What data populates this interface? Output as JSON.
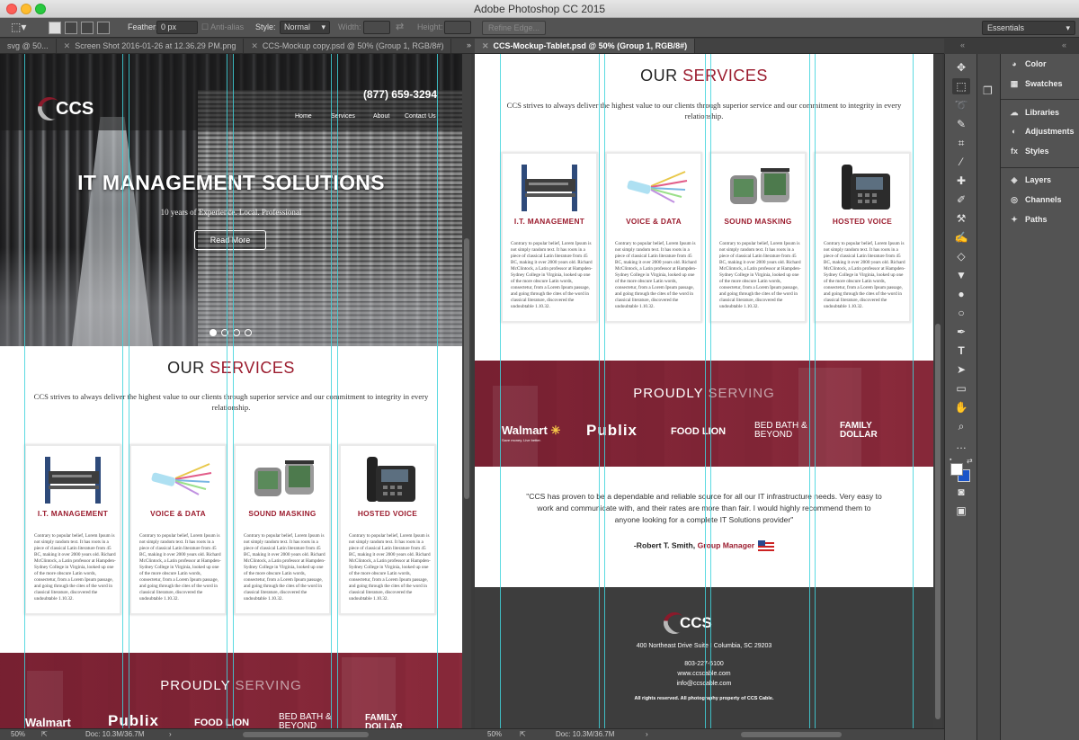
{
  "app": {
    "title": "Adobe Photoshop CC 2015"
  },
  "options_bar": {
    "feather_label": "Feather:",
    "feather_value": "0 px",
    "antialias_label": "Anti-alias",
    "style_label": "Style:",
    "style_value": "Normal",
    "width_label": "Width:",
    "height_label": "Height:",
    "refine_edge": "Refine Edge...",
    "workspace": "Essentials"
  },
  "tabs_left": [
    "svg @ 50...",
    "Screen Shot 2016-01-26 at 12.36.29 PM.png",
    "CCS-Mockup copy.psd @ 50% (Group 1, RGB/8#)"
  ],
  "tab_right": "CCS-Mockup-Tablet.psd @ 50% (Group 1, RGB/8#)",
  "status": {
    "zoom": "50%",
    "doc": "Doc: 10.3M/36.7M"
  },
  "site": {
    "logo": "CCS",
    "phone": "(877) 659-3294",
    "nav": [
      "Home",
      "Services",
      "About",
      "Contact Us"
    ],
    "hero_title": "IT MANAGEMENT SOLUTIONS",
    "hero_subtitle": "10 years of Experience. Local. Professional",
    "hero_button": "Read More",
    "services_heading_a": "OUR",
    "services_heading_b": "SERVICES",
    "services_intro": "CCS strives to always deliver the highest value to our clients through superior service and our commitment to integrity in every relationship.",
    "cards": [
      {
        "title": "I.T. MANAGEMENT",
        "icon": "server-rack-icon",
        "text": "Contrary to popular belief, Lorem Ipsum is not simply random text. It has roots in a piece of classical Latin literature from 45 BC, making it over 2000 years old. Richard McClintock, a Latin professor at Hampden-Sydney College in Virginia, looked up one of the more obscure Latin words, consectetur, from a Lorem Ipsum passage, and going through the cites of the word in classical literature, discovered the undoubtable 1.10.32."
      },
      {
        "title": "VOICE & DATA",
        "icon": "cable-icon",
        "text": "Contrary to popular belief, Lorem Ipsum is not simply random text. It has roots in a piece of classical Latin literature from 45 BC, making it over 2000 years old. Richard McClintock, a Latin professor at Hampden-Sydney College in Virginia, looked up one of the more obscure Latin words, consectetur, from a Lorem Ipsum passage, and going through the cites of the word in classical literature, discovered the undoubtable 1.10.32."
      },
      {
        "title": "SOUND MASKING",
        "icon": "sound-unit-icon",
        "text": "Contrary to popular belief, Lorem Ipsum is not simply random text. It has roots in a piece of classical Latin literature from 45 BC, making it over 2000 years old. Richard McClintock, a Latin professor at Hampden-Sydney College in Virginia, looked up one of the more obscure Latin words, consectetur, from a Lorem Ipsum passage, and going through the cites of the word in classical literature, discovered the undoubtable 1.10.32."
      },
      {
        "title": "HOSTED VOICE",
        "icon": "desk-phone-icon",
        "text": "Contrary to popular belief, Lorem Ipsum is not simply random text. It has roots in a piece of classical Latin literature from 45 BC, making it over 2000 years old. Richard McClintock, a Latin professor at Hampden-Sydney College in Virginia, looked up one of the more obscure Latin words, consectetur, from a Lorem Ipsum passage, and going through the cites of the word in classical literature, discovered the undoubtable 1.10.32."
      }
    ],
    "serving_a": "PROUDLY",
    "serving_b": "SERVING",
    "brands": [
      "Walmart",
      "Publix",
      "FOOD LION",
      "BED BATH & BEYOND",
      "FAMILY DOLLAR"
    ],
    "walmart_tag": "Save money. Live better.",
    "testimonial": "\"CCS has proven to be a dependable and reliable source for all our IT infrastructure needs. Very easy to work and communicate with, and their rates are more than fair. I would highly recommend them to anyone looking for a complete IT Solutions provider\"",
    "author": "-Robert T. Smith,",
    "author_role": "Group Manager",
    "address": "400 Northeast Drive Suite I Columbia, SC 29203",
    "footer_phone": "803-227-5100",
    "website": "www.ccscable.com",
    "email": "info@ccscable.com",
    "rights": "All rights reserved. All photography property of CCS Cable."
  },
  "panels": [
    {
      "label": "Color",
      "icon": "color-icon"
    },
    {
      "label": "Swatches",
      "icon": "swatches-icon"
    },
    {
      "label": "Libraries",
      "icon": "libraries-icon"
    },
    {
      "label": "Adjustments",
      "icon": "adjustments-icon"
    },
    {
      "label": "Styles",
      "icon": "styles-icon"
    },
    {
      "label": "Layers",
      "icon": "layers-icon"
    },
    {
      "label": "Channels",
      "icon": "channels-icon"
    },
    {
      "label": "Paths",
      "icon": "paths-icon"
    }
  ],
  "colors": {
    "brand_red": "#9b1c2e",
    "guide": "#3fd3dc",
    "panel_bg": "#535353"
  }
}
